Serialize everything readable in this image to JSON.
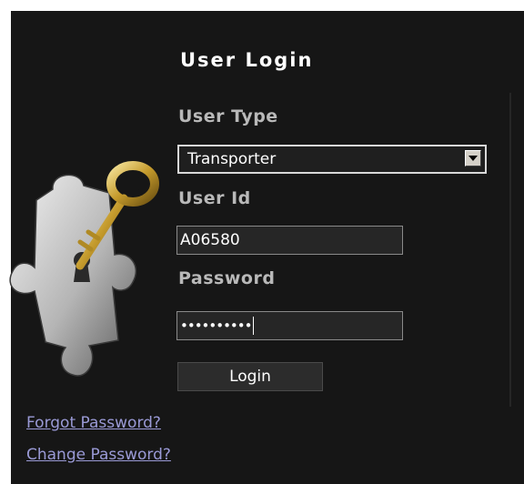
{
  "login": {
    "title": "User Login",
    "user_type_label": "User Type",
    "user_type_value": "Transporter",
    "user_id_label": "User Id",
    "user_id_value": "A06580",
    "password_label": "Password",
    "password_masked": "••••••••••",
    "login_button": "Login"
  },
  "links": {
    "forgot_password": "Forgot Password?",
    "change_password": "Change Password?"
  },
  "icons": {
    "emblem": "puzzle-key-icon",
    "dropdown": "chevron-down-icon"
  },
  "colors": {
    "panel_bg": "#161616",
    "link": "#9a9ad6",
    "label": "#b9b9b9"
  }
}
